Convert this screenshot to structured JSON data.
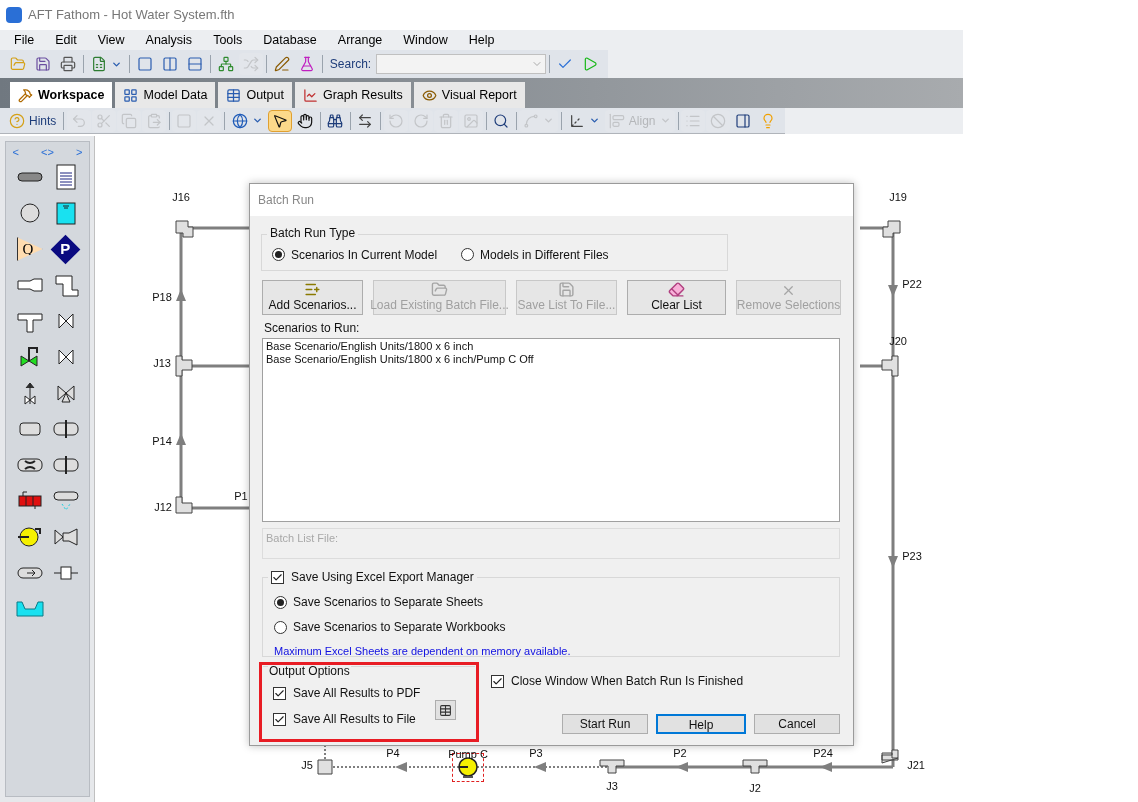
{
  "window": {
    "title": "AFT Fathom - Hot Water System.fth"
  },
  "menu": [
    "File",
    "Edit",
    "View",
    "Analysis",
    "Tools",
    "Database",
    "Arrange",
    "Window",
    "Help"
  ],
  "toolbar": {
    "search_label": "Search:",
    "tools": [
      {
        "disabled": false
      },
      {
        "disabled": false
      },
      {
        "disabled": false
      },
      {
        "disabled": false
      },
      {
        "disabled": false
      },
      {
        "disabled": false
      },
      {
        "disabled": false
      },
      {
        "disabled": false
      },
      {
        "disabled": true
      },
      {
        "disabled": false
      },
      {
        "disabled": false
      },
      {
        "disabled": false
      },
      {
        "disabled": false
      }
    ]
  },
  "tabs": [
    {
      "label": "Workspace",
      "selected": true
    },
    {
      "label": "Model Data",
      "selected": false
    },
    {
      "label": "Output",
      "selected": false
    },
    {
      "label": "Graph Results",
      "selected": false
    },
    {
      "label": "Visual Report",
      "selected": false
    }
  ],
  "workspace_toolbar": {
    "tools": [
      {
        "label": "Hints",
        "disabled": false,
        "selected": false
      },
      {
        "disabled": true,
        "selected": false
      },
      {
        "disabled": true,
        "selected": false
      },
      {
        "disabled": true,
        "selected": false
      },
      {
        "disabled": true,
        "selected": false
      },
      {
        "disabled": true,
        "selected": false
      },
      {
        "disabled": true,
        "selected": false
      },
      {
        "disabled": false,
        "selected": false
      },
      {
        "disabled": false,
        "selected": true
      },
      {
        "disabled": false,
        "selected": false
      },
      {
        "disabled": false,
        "selected": false
      },
      {
        "disabled": false,
        "selected": false
      },
      {
        "disabled": true,
        "selected": false
      },
      {
        "disabled": true,
        "selected": false
      },
      {
        "disabled": true,
        "selected": false
      },
      {
        "disabled": true,
        "selected": false
      },
      {
        "disabled": false,
        "selected": false
      },
      {
        "disabled": true,
        "selected": false
      },
      {
        "disabled": false,
        "selected": false
      },
      {
        "label": "Align",
        "disabled": true,
        "selected": false
      },
      {
        "disabled": true,
        "selected": false
      },
      {
        "disabled": true,
        "selected": false
      },
      {
        "disabled": false,
        "selected": false
      },
      {
        "disabled": false,
        "selected": false
      }
    ]
  },
  "palette": {
    "nav": [
      "<",
      "<>",
      ">"
    ],
    "badges": [
      "Q",
      "P"
    ]
  },
  "canvas": {
    "labels": [
      "J16",
      "J19",
      "P18",
      "P22",
      "J13",
      "J20",
      "P14",
      "J12",
      "P1",
      "P23",
      "J5",
      "P4",
      "Pump C",
      "P3",
      "P2",
      "P24",
      "J21",
      "J3",
      "J2"
    ]
  },
  "dialog": {
    "title": "Batch Run",
    "run_type": {
      "title": "Batch Run Type",
      "options": [
        {
          "label": "Scenarios In Current Model",
          "selected": true
        },
        {
          "label": "Models in Different Files",
          "selected": false
        }
      ]
    },
    "buttons": [
      {
        "label": "Add Scenarios...",
        "disabled": false
      },
      {
        "label": "Load Existing Batch File...",
        "disabled": true
      },
      {
        "label": "Save List To File...",
        "disabled": true
      },
      {
        "label": "Clear List",
        "disabled": false
      },
      {
        "label": "Remove Selections",
        "disabled": true
      }
    ],
    "scenarios_label": "Scenarios to Run:",
    "scenarios": [
      "Base Scenario/English Units/1800 x 6 inch",
      "Base Scenario/English Units/1800 x 6 inch/Pump C Off"
    ],
    "batch_list_file": {
      "label": "Batch List File:",
      "disabled": true
    },
    "excel": {
      "label": "Save Using Excel Export Manager",
      "checked": true,
      "options": [
        {
          "label": "Save Scenarios to Separate Sheets",
          "selected": true
        },
        {
          "label": "Save Scenarios to Separate Workbooks",
          "selected": false
        }
      ],
      "note": "Maximum Excel Sheets are dependent on memory available."
    },
    "output_options": {
      "title": "Output Options",
      "items": [
        {
          "label": "Save All Results to PDF",
          "checked": true
        },
        {
          "label": "Save All Results to File",
          "checked": true
        }
      ]
    },
    "close_window": {
      "label": "Close Window When Batch Run Is Finished",
      "checked": true
    },
    "actions": [
      {
        "label": "Start Run",
        "focused": false
      },
      {
        "label": "Help",
        "focused": true
      },
      {
        "label": "Cancel",
        "focused": false
      }
    ]
  }
}
